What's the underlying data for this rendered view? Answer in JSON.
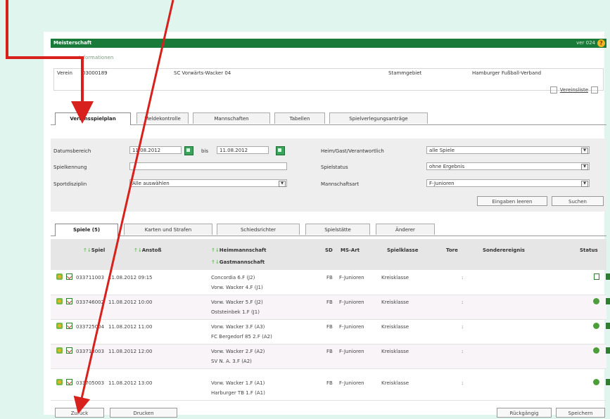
{
  "window": {
    "title": "Meisterschaft",
    "version": "ver 024"
  },
  "club": {
    "section_label": "Informationen",
    "verein_label": "Verein",
    "verein_id": "03000189",
    "verein_name": "SC Vorwärts-Wacker 04",
    "stammgebiet_label": "Stammgebiet",
    "verband": "Hamburger Fußball-Verband",
    "vereinsliste_link": "Vereinsliste"
  },
  "main_tabs": [
    {
      "label": "Vereinsspielplan",
      "active": true
    },
    {
      "label": "Meldekontrolle"
    },
    {
      "label": "Mannschaften"
    },
    {
      "label": "Tabellen"
    },
    {
      "label": "Spielverlegungsanträge"
    }
  ],
  "filters": {
    "datumsbereich_label": "Datumsbereich",
    "date_from": "11.08.2012",
    "bis_label": "bis",
    "date_to": "11.08.2012",
    "spielkennung_label": "Spielkennung",
    "spielkennung_value": "",
    "sportdisziplin_label": "Sportdisziplin",
    "sportdisziplin_value": "Alle auswählen",
    "heim_label": "Heim/Gast/Verantwortlich",
    "heim_value": "alle Spiele",
    "spielstatus_label": "Spielstatus",
    "spielstatus_value": "ohne Ergebnis",
    "mannschaftsart_label": "Mannschaftsart",
    "mannschaftsart_value": "F-Junioren",
    "clear_button": "Eingaben leeren",
    "search_button": "Suchen"
  },
  "sub_tabs": [
    {
      "label": "Spiele (5)",
      "active": true
    },
    {
      "label": "Karten und Strafen"
    },
    {
      "label": "Schiedsrichter"
    },
    {
      "label": "Spielstätte"
    },
    {
      "label": "Änderer"
    }
  ],
  "grid": {
    "headers": {
      "spiel": "Spiel",
      "anstoss": "Anstoß",
      "heim": "Heimmannschaft",
      "gast": "Gastmannschaft",
      "sd": "SD",
      "ms_art": "MS-Art",
      "spielklasse": "Spielklasse",
      "tore": "Tore",
      "sonderereignis": "Sonderereignis",
      "status": "Status"
    },
    "rows": [
      {
        "spiel": "033711003",
        "anstoss": "11.08.2012 09:15",
        "heim": "Concordia 6.F (J2)",
        "gast": "Vorw. Wacker 4.F (J1)",
        "sd": "FB",
        "ms_art": "F-Junioren",
        "spielklasse": "Kreisklasse",
        "tore": ":"
      },
      {
        "spiel": "033746002",
        "anstoss": "11.08.2012 10:00",
        "heim": "Vorw. Wacker 5.F (J2)",
        "gast": "Oststeinbek 1.F (J1)",
        "sd": "FB",
        "ms_art": "F-Junioren",
        "spielklasse": "Kreisklasse",
        "tore": ":"
      },
      {
        "spiel": "033725004",
        "anstoss": "11.08.2012 11:00",
        "heim": "Vorw. Wacker 3.F (A3)",
        "gast": "FC Bergedorf 85 2.F (A2)",
        "sd": "FB",
        "ms_art": "F-Junioren",
        "spielklasse": "Kreisklasse",
        "tore": ":"
      },
      {
        "spiel": "033713003",
        "anstoss": "11.08.2012 12:00",
        "heim": "Vorw. Wacker 2.F (A2)",
        "gast": "SV N. A. 3.F (A2)",
        "sd": "FB",
        "ms_art": "F-Junioren",
        "spielklasse": "Kreisklasse",
        "tore": ":"
      },
      {
        "spiel": "033705003",
        "anstoss": "11.08.2012 13:00",
        "heim": "Vorw. Wacker 1.F (A1)",
        "gast": "Harburger TB 1.F (A1)",
        "sd": "FB",
        "ms_art": "F-Junioren",
        "spielklasse": "Kreisklasse",
        "tore": ":"
      }
    ]
  },
  "footer": {
    "back_button": "Zurück",
    "print_button": "Drucken",
    "undo_button": "Rückgängig",
    "save_button": "Speichern"
  },
  "annotation_color": "#d8201c",
  "accent_color": "#1a7a3a"
}
